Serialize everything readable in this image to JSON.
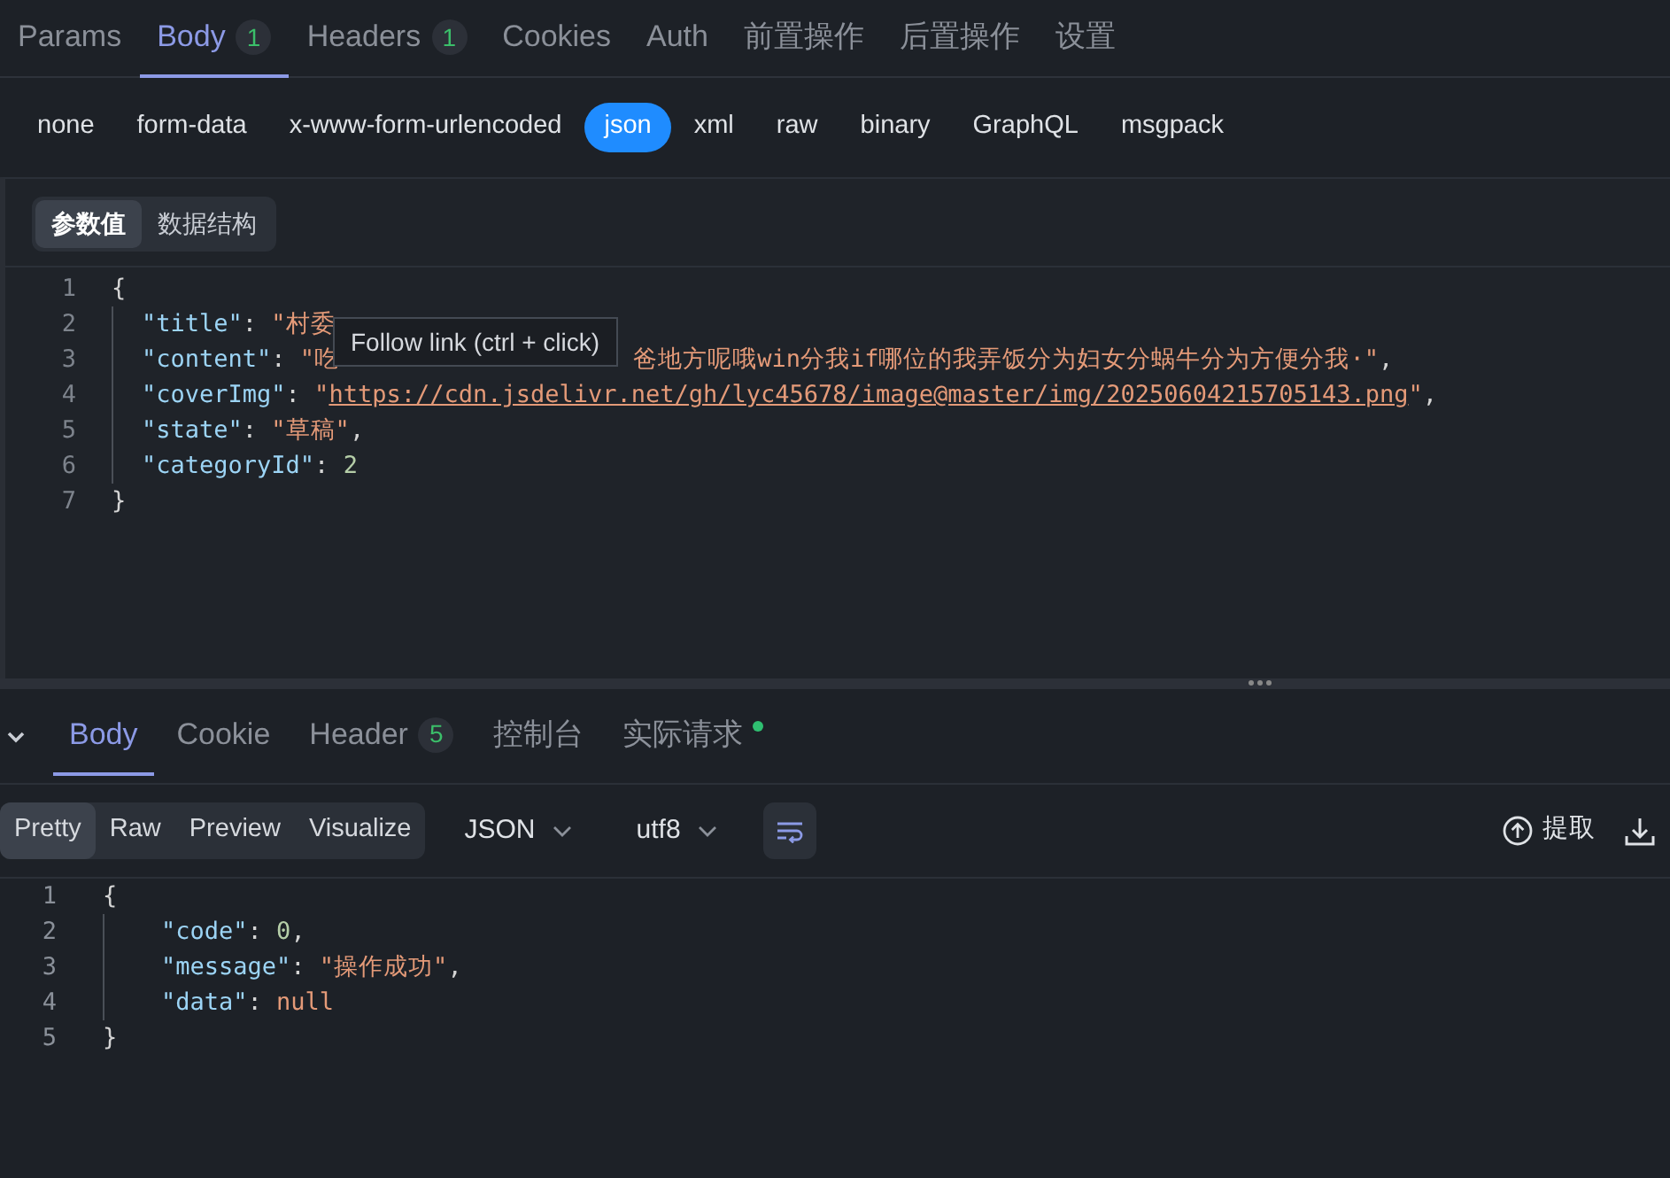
{
  "request_tabs": [
    {
      "label": "Params",
      "selected": false
    },
    {
      "label": "Body",
      "badge": "1",
      "selected": true
    },
    {
      "label": "Headers",
      "badge": "1",
      "selected": false
    },
    {
      "label": "Cookies",
      "selected": false
    },
    {
      "label": "Auth",
      "selected": false
    },
    {
      "label": "前置操作",
      "selected": false
    },
    {
      "label": "后置操作",
      "selected": false
    },
    {
      "label": "设置",
      "selected": false
    }
  ],
  "body_types": [
    {
      "label": "none",
      "selected": false
    },
    {
      "label": "form-data",
      "selected": false
    },
    {
      "label": "x-www-form-urlencoded",
      "selected": false
    },
    {
      "label": "json",
      "selected": true
    },
    {
      "label": "xml",
      "selected": false
    },
    {
      "label": "raw",
      "selected": false
    },
    {
      "label": "binary",
      "selected": false
    },
    {
      "label": "GraphQL",
      "selected": false
    },
    {
      "label": "msgpack",
      "selected": false
    }
  ],
  "editor_tabs": [
    {
      "label": "参数值",
      "selected": true
    },
    {
      "label": "数据结构",
      "selected": false
    }
  ],
  "request_body": {
    "lines": [
      {
        "number": "1",
        "indented": false,
        "tokens": [
          {
            "kind": "punct",
            "text": "{"
          }
        ]
      },
      {
        "number": "2",
        "indented": true,
        "tokens": [
          {
            "kind": "key",
            "text": "\"title\""
          },
          {
            "kind": "punct",
            "text": ": "
          },
          {
            "kind": "string",
            "text": "\"村委"
          }
        ]
      },
      {
        "number": "3",
        "indented": true,
        "tokens": [
          {
            "kind": "key",
            "text": "\"content\""
          },
          {
            "kind": "punct",
            "text": ": "
          },
          {
            "kind": "string",
            "text": "\"吃"
          },
          {
            "kind": "covered"
          },
          {
            "kind": "string",
            "text": "爸地方呢哦win分我if哪位的我弄饭分为妇女分蜗牛分为方便分我·\""
          },
          {
            "kind": "punct",
            "text": ","
          }
        ]
      },
      {
        "number": "4",
        "indented": true,
        "tokens": [
          {
            "kind": "key",
            "text": "\"coverImg\""
          },
          {
            "kind": "punct",
            "text": ": "
          },
          {
            "kind": "string",
            "text": "\""
          },
          {
            "kind": "link",
            "text": "https://cdn.jsdelivr.net/gh/lyc45678/image@master/img/20250604215705143.png"
          },
          {
            "kind": "string",
            "text": "\""
          },
          {
            "kind": "punct",
            "text": ","
          }
        ]
      },
      {
        "number": "5",
        "indented": true,
        "tokens": [
          {
            "kind": "key",
            "text": "\"state\""
          },
          {
            "kind": "punct",
            "text": ": "
          },
          {
            "kind": "string",
            "text": "\"草稿\""
          },
          {
            "kind": "punct",
            "text": ","
          }
        ]
      },
      {
        "number": "6",
        "indented": true,
        "tokens": [
          {
            "kind": "key",
            "text": "\"categoryId\""
          },
          {
            "kind": "punct",
            "text": ": "
          },
          {
            "kind": "number",
            "text": "2"
          }
        ]
      },
      {
        "number": "7",
        "indented": false,
        "tokens": [
          {
            "kind": "punct",
            "text": "}"
          }
        ]
      }
    ]
  },
  "tooltip": {
    "link": "Follow link",
    "hint": "(ctrl + click)"
  },
  "response_tabs": [
    {
      "label": "Body",
      "selected": true
    },
    {
      "label": "Cookie",
      "selected": false
    },
    {
      "label": "Header",
      "badge": "5",
      "selected": false
    },
    {
      "label": "控制台",
      "selected": false
    },
    {
      "label": "实际请求",
      "indicator": true,
      "selected": false
    }
  ],
  "view_modes": [
    {
      "label": "Pretty",
      "selected": true
    },
    {
      "label": "Raw",
      "selected": false
    },
    {
      "label": "Preview",
      "selected": false
    },
    {
      "label": "Visualize",
      "selected": false
    }
  ],
  "format_select": "JSON",
  "encoding_select": "utf8",
  "extract_button": "提取",
  "response_body": {
    "lines": [
      {
        "number": "1",
        "indented": false,
        "tokens": [
          {
            "kind": "punct",
            "text": "{"
          }
        ]
      },
      {
        "number": "2",
        "indented": true,
        "tokens": [
          {
            "kind": "key",
            "text": "\"code\""
          },
          {
            "kind": "punct",
            "text": ": "
          },
          {
            "kind": "number",
            "text": "0"
          },
          {
            "kind": "punct",
            "text": ","
          }
        ]
      },
      {
        "number": "3",
        "indented": true,
        "tokens": [
          {
            "kind": "key",
            "text": "\"message\""
          },
          {
            "kind": "punct",
            "text": ": "
          },
          {
            "kind": "string",
            "text": "\"操作成功\""
          },
          {
            "kind": "punct",
            "text": ","
          }
        ]
      },
      {
        "number": "4",
        "indented": true,
        "tokens": [
          {
            "kind": "key",
            "text": "\"data\""
          },
          {
            "kind": "punct",
            "text": ": "
          },
          {
            "kind": "keyword",
            "text": "null"
          }
        ]
      },
      {
        "number": "5",
        "indented": false,
        "tokens": [
          {
            "kind": "punct",
            "text": "}"
          }
        ]
      }
    ]
  }
}
